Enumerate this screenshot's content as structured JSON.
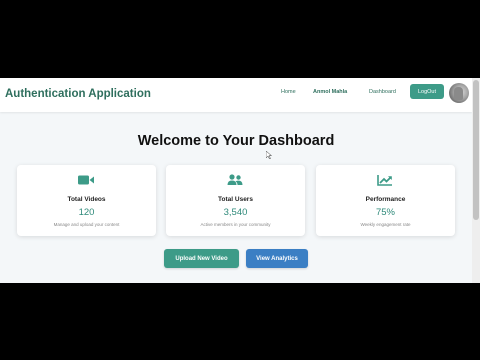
{
  "header": {
    "app_title": "Authentication Application",
    "nav": {
      "home": "Home",
      "user": "Anmol Mahla",
      "dashboard": "Dashboard"
    },
    "logout_label": "LogOut"
  },
  "main": {
    "welcome": "Welcome to Your Dashboard",
    "cards": [
      {
        "icon": "video-camera-icon",
        "title": "Total Videos",
        "value": "120",
        "subtitle": "Manage and upload your content"
      },
      {
        "icon": "users-icon",
        "title": "Total Users",
        "value": "3,540",
        "subtitle": "Active members in your community"
      },
      {
        "icon": "trending-up-icon",
        "title": "Performance",
        "value": "75%",
        "subtitle": "Weekly engagement rate"
      }
    ],
    "actions": {
      "upload": "Upload New Video",
      "analytics": "View Analytics"
    }
  },
  "colors": {
    "primary": "#3d9b88",
    "secondary": "#3b7fc4",
    "accent_text": "#2f8a7a"
  }
}
